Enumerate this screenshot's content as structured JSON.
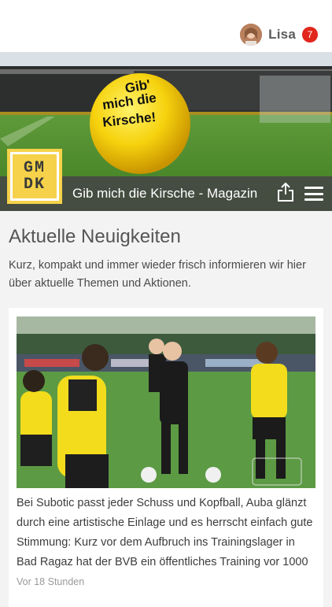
{
  "header": {
    "username": "Lisa",
    "notifications": "7",
    "avatar_icon": "user-avatar"
  },
  "hero": {
    "ball_text_line1": "Gib'",
    "ball_text_line2": "mich die",
    "ball_text_line3": "Kirsche!",
    "logo_line1": "GM",
    "logo_line2": "DK",
    "magazine_title": "Gib mich die Kirsche - Magazin",
    "share_icon": "share-icon",
    "menu_icon": "hamburger-menu-icon"
  },
  "section": {
    "title": "Aktuelle Neuigkeiten",
    "description": "Kurz, kompakt und immer wieder frisch informieren wir hier über aktuelle Themen und Aktionen."
  },
  "article": {
    "text": "Bei Subotic passt jeder Schuss und Kopfball, Auba glänzt durch eine artistische Einlage und es herrscht einfach gute Stimmung: Kurz vor dem Aufbruch ins Trainingslager in Bad Ragaz hat der BVB ein öffentliches Training vor 1000",
    "time": "Vor 18 Stunden"
  },
  "colors": {
    "accent_yellow": "#f5d24a",
    "badge_red": "#e1261c",
    "title_bar": "#464646"
  }
}
